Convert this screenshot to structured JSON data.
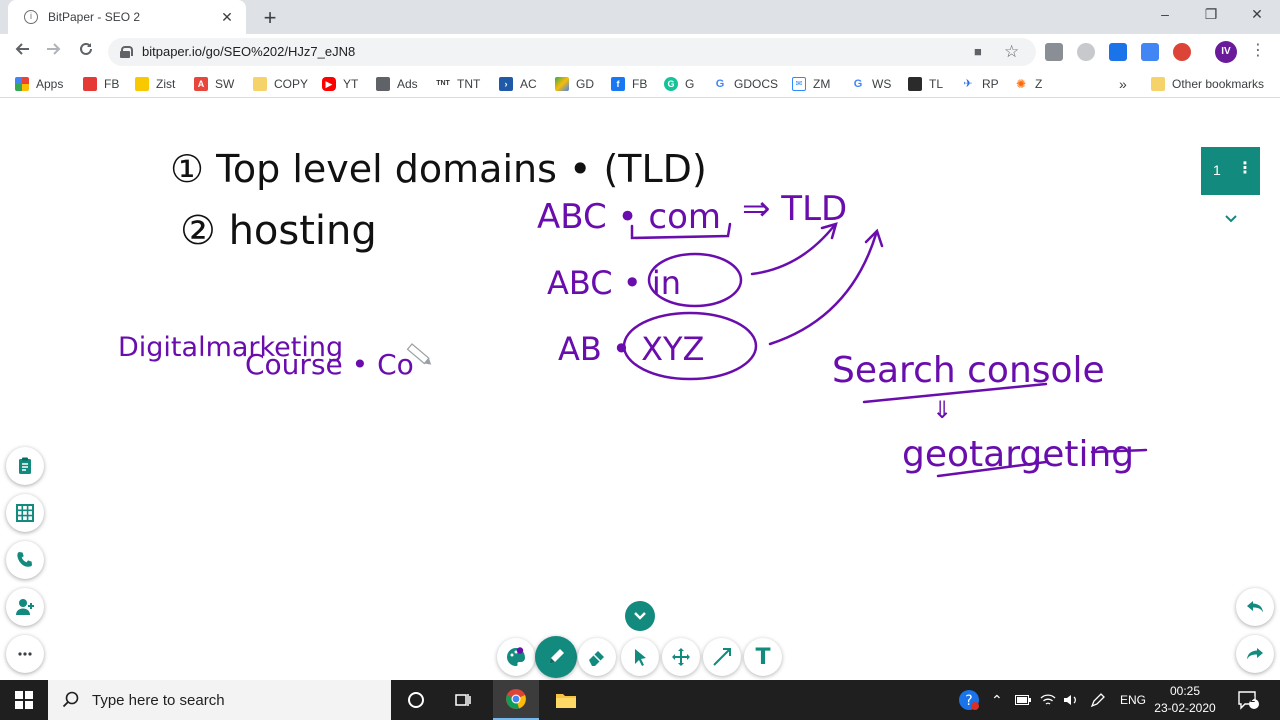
{
  "browser": {
    "tab_title": "BitPaper - SEO 2",
    "tab_close": "✕",
    "new_tab": "+",
    "url": "bitpaper.io/go/SEO%202/HJz7_eJN8",
    "profile_initials": "IV",
    "window_controls": {
      "minimize": "–",
      "restore": "❐",
      "close": "✕"
    }
  },
  "bookmarks": [
    {
      "label": "Apps",
      "color": "#ea4335"
    },
    {
      "label": "FB",
      "color": "#e53935"
    },
    {
      "label": "Zist",
      "color": "#f9c900"
    },
    {
      "label": "SW",
      "color": "#e8453c"
    },
    {
      "label": "COPY",
      "color": "#f6d26b"
    },
    {
      "label": "YT",
      "color": "#ff0000"
    },
    {
      "label": "Ads",
      "color": "#5f6368"
    },
    {
      "label": "TNT",
      "color": "#333333"
    },
    {
      "label": "AC",
      "color": "#1e5aa8"
    },
    {
      "label": "GD",
      "color": "#34a853"
    },
    {
      "label": "FB",
      "color": "#1877f2"
    },
    {
      "label": "G",
      "color": "#15c39a"
    },
    {
      "label": "GDOCS",
      "color": "#4285f4"
    },
    {
      "label": "ZM",
      "color": "#2d8cff"
    },
    {
      "label": "WS",
      "color": "#4285f4"
    },
    {
      "label": "TL",
      "color": "#2b2b2b"
    },
    {
      "label": "RP",
      "color": "#2d6cdf"
    },
    {
      "label": "Z",
      "color": "#ff6a00"
    }
  ],
  "bookmarks_more": "»",
  "other_bookmarks": "Other bookmarks",
  "board": {
    "ink_color": "#6a0dad",
    "accent": "#128a7d",
    "page_number": "1",
    "page_menu": "⋮",
    "handwriting": {
      "line1": "① Top level domains • (TLD)",
      "line2": "② hosting",
      "digital": "Digitalmarketing",
      "course": "Course • Co",
      "abc_com": "ABC • com",
      "arrow_tld": "⇒ TLD",
      "abc_in": "ABC • in",
      "abc_xyz": "AB • XYZ",
      "search_console": "Search console",
      "down_arrow": "⇓",
      "geotargeting": "geotargeting"
    }
  },
  "taskbar": {
    "search_placeholder": "Type here to search",
    "language": "ENG",
    "time": "00:25",
    "date": "23-02-2020",
    "notifications_count": "2"
  }
}
